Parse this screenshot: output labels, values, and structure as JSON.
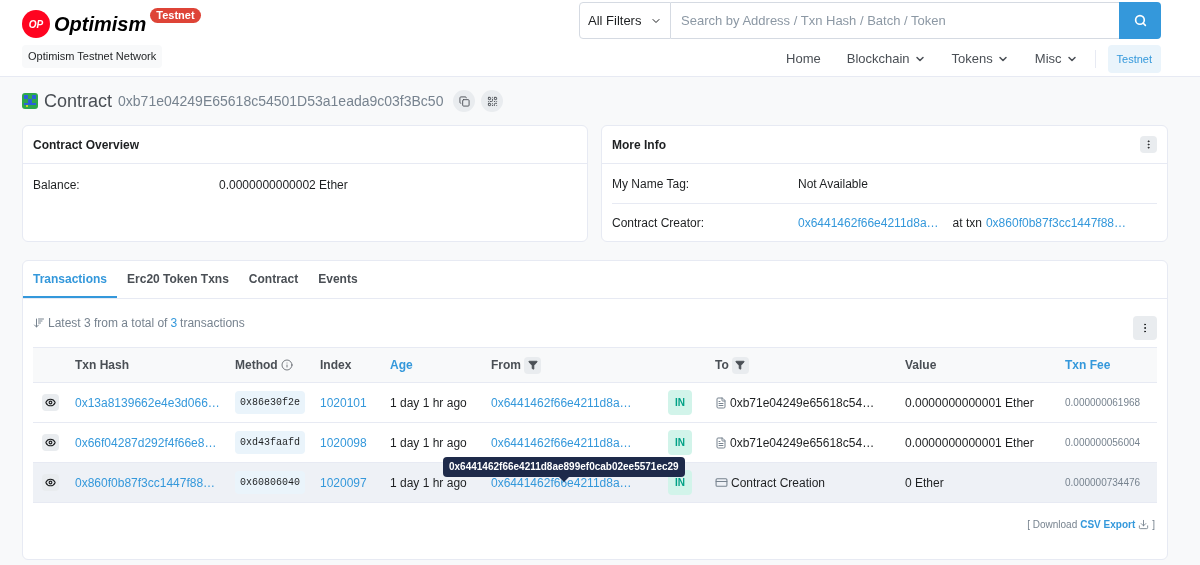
{
  "header": {
    "logo_mark": "OP",
    "logo_text": "Optimism",
    "network_badge": "Testnet",
    "network_name": "Optimism Testnet Network"
  },
  "search": {
    "filter": "All Filters",
    "placeholder": "Search by Address / Txn Hash / Batch / Token"
  },
  "nav": [
    {
      "label": "Home",
      "dropdown": false
    },
    {
      "label": "Blockchain",
      "dropdown": true
    },
    {
      "label": "Tokens",
      "dropdown": true
    },
    {
      "label": "Misc",
      "dropdown": true
    }
  ],
  "nav_badge": "Testnet",
  "page": {
    "title": "Contract",
    "address": "0xb71e04249E65618c54501D53a1eada9c03f3Bc50"
  },
  "overview": {
    "title": "Contract Overview",
    "rows": [
      {
        "label": "Balance:",
        "value": "0.0000000000002 Ether"
      }
    ]
  },
  "more_info": {
    "title": "More Info",
    "name_tag_label": "My Name Tag:",
    "name_tag": "Not Available",
    "creator_label": "Contract Creator:",
    "creator": "0x6441462f66e4211d8a…",
    "at_txn": "at txn",
    "creator_txn": "0x860f0b87f3cc1447f88…"
  },
  "tabs": [
    {
      "label": "Transactions",
      "selected": true
    },
    {
      "label": "Erc20 Token Txns",
      "selected": false
    },
    {
      "label": "Contract",
      "selected": false
    },
    {
      "label": "Events",
      "selected": false
    }
  ],
  "summary": {
    "prefix": "Latest 3 from a total of",
    "count": "3",
    "suffix": "transactions"
  },
  "table": {
    "columns": [
      {
        "label": "Txn Hash",
        "kind": "plain"
      },
      {
        "label": "Method",
        "kind": "info"
      },
      {
        "label": "Index",
        "kind": "plain"
      },
      {
        "label": "Age",
        "kind": "link"
      },
      {
        "label": "From",
        "kind": "filter"
      },
      {
        "label": "To",
        "kind": "filter"
      },
      {
        "label": "Value",
        "kind": "plain"
      },
      {
        "label": "Txn Fee",
        "kind": "link"
      }
    ],
    "rows": [
      {
        "hash": "0x13a8139662e4e3d066…",
        "method": "0x86e30f2e",
        "index": "1020101",
        "age": "1 day 1 hr ago",
        "from": "0x6441462f66e4211d8a…",
        "direction": "IN",
        "kind": "contract",
        "to": "0xb71e04249e65618c54…",
        "value": "0.0000000000001 Ether",
        "fee": "0.000000061968",
        "hovered": false
      },
      {
        "hash": "0x66f04287d292f4f66e8…",
        "method": "0xd43faafd",
        "index": "1020098",
        "age": "1 day 1 hr ago",
        "from": "0x6441462f66e4211d8a…",
        "direction": "IN",
        "kind": "contract",
        "to": "0xb71e04249e65618c54…",
        "value": "0.0000000000001 Ether",
        "fee": "0.000000056004",
        "hovered": false
      },
      {
        "hash": "0x860f0b87f3cc1447f88…",
        "method": "0x60806040",
        "index": "1020097",
        "age": "1 day 1 hr ago",
        "from": "0x6441462f66e4211d8a…",
        "direction": "IN",
        "kind": "creation",
        "to": "Contract Creation",
        "value": "0 Ether",
        "fee": "0.000000734476",
        "hovered": true
      }
    ]
  },
  "tooltip": "0x6441462f66e4211d8ae899ef0cab02ee5571ec29",
  "footer": {
    "prefix": "[ Download",
    "link": "CSV Export",
    "suffix": "]"
  }
}
